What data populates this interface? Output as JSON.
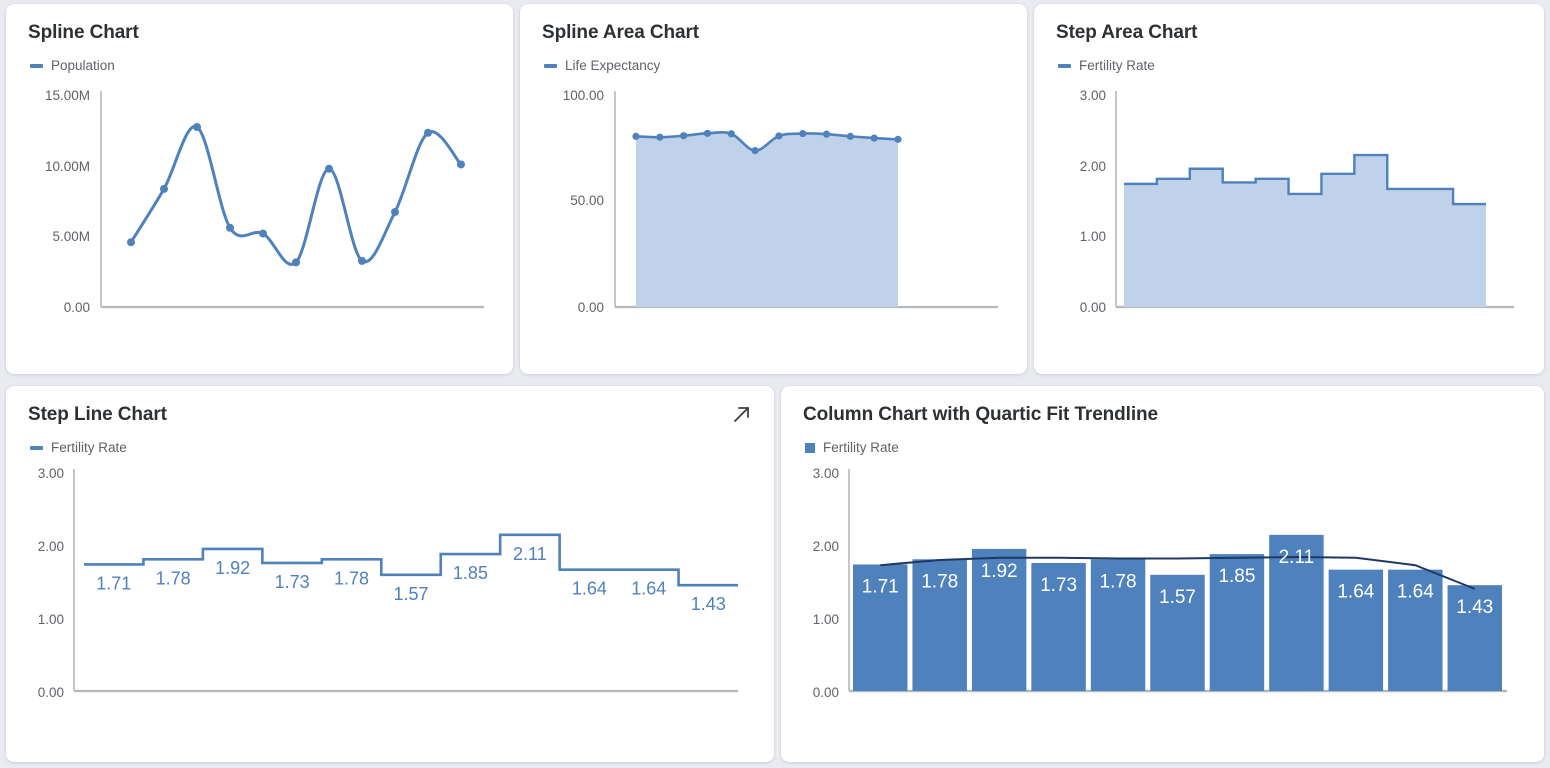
{
  "theme": {
    "page_bg": "#e9ebf1",
    "card_bg": "#ffffff",
    "accent": "#4f81bd",
    "area_fill": "#bfd2ea",
    "trendline": "#1f3864",
    "axis_text": "#5f6368",
    "title_text": "#2d3134"
  },
  "cards": {
    "spline": {
      "title": "Spline Chart",
      "legend": "Population",
      "legend_marker": "line-marker-icon"
    },
    "spline_area": {
      "title": "Spline Area Chart",
      "legend": "Life Expectancy",
      "legend_marker": "line-marker-icon"
    },
    "step_area": {
      "title": "Step Area Chart",
      "legend": "Fertility Rate",
      "legend_marker": "line-marker-icon"
    },
    "step_line": {
      "title": "Step Line Chart",
      "legend": "Fertility Rate",
      "legend_marker": "line-marker-icon",
      "expand_icon": "expand-arrow-icon"
    },
    "column": {
      "title": "Column Chart with Quartic Fit Trendline",
      "legend": "Fertility Rate",
      "legend_marker": "square-marker-icon"
    }
  },
  "chart_data": [
    {
      "id": "spline",
      "type": "line",
      "title": "Spline Chart",
      "xlabel": "",
      "ylabel": "",
      "legend": [
        "Population"
      ],
      "legend_position": "top-left",
      "grid": false,
      "smooth": true,
      "markers": true,
      "ylim": [
        0,
        15000000
      ],
      "yticks": [
        0,
        5000000,
        10000000,
        15000000
      ],
      "ytick_labels": [
        "0.00",
        "5.00M",
        "10.00M",
        "15.00M"
      ],
      "x": [
        1,
        2,
        3,
        4,
        5,
        6,
        7,
        8,
        9,
        10,
        11
      ],
      "series": [
        {
          "name": "Population",
          "color": "#4f81bd",
          "values": [
            4500000,
            8200000,
            12500000,
            5500000,
            5100000,
            3100000,
            9600000,
            3200000,
            6600000,
            12100000,
            9900000
          ]
        }
      ]
    },
    {
      "id": "spline_area",
      "type": "area",
      "title": "Spline Area Chart",
      "xlabel": "",
      "ylabel": "",
      "legend": [
        "Life Expectancy"
      ],
      "legend_position": "top-left",
      "grid": false,
      "smooth": true,
      "markers": true,
      "ylim": [
        0,
        100
      ],
      "yticks": [
        0,
        50,
        100
      ],
      "ytick_labels": [
        "0.00",
        "50.00",
        "100.00"
      ],
      "x": [
        1,
        2,
        3,
        4,
        5,
        6,
        7,
        8,
        9,
        10,
        11,
        12
      ],
      "series": [
        {
          "name": "Life Expectancy",
          "color": "#4f81bd",
          "fill": "#bfd2ea",
          "values": [
            79.0,
            78.6,
            79.3,
            80.4,
            80.2,
            72.4,
            79.2,
            80.3,
            80.0,
            79.0,
            78.2,
            77.6
          ]
        }
      ]
    },
    {
      "id": "step_area",
      "type": "area",
      "title": "Step Area Chart",
      "xlabel": "",
      "ylabel": "",
      "legend": [
        "Fertility Rate"
      ],
      "legend_position": "top-left",
      "grid": false,
      "step": true,
      "ylim": [
        0,
        3
      ],
      "yticks": [
        0,
        1,
        2,
        3
      ],
      "ytick_labels": [
        "0.00",
        "1.00",
        "2.00",
        "3.00"
      ],
      "x": [
        1,
        2,
        3,
        4,
        5,
        6,
        7,
        8,
        9,
        10,
        11
      ],
      "series": [
        {
          "name": "Fertility Rate",
          "color": "#4f81bd",
          "fill": "#bfd2ea",
          "values": [
            1.71,
            1.78,
            1.92,
            1.73,
            1.78,
            1.57,
            1.85,
            2.11,
            1.64,
            1.64,
            1.43
          ]
        }
      ]
    },
    {
      "id": "step_line",
      "type": "line",
      "title": "Step Line Chart",
      "xlabel": "",
      "ylabel": "",
      "legend": [
        "Fertility Rate"
      ],
      "legend_position": "top-left",
      "grid": false,
      "step": true,
      "data_labels": true,
      "ylim": [
        0,
        3
      ],
      "yticks": [
        0,
        1,
        2,
        3
      ],
      "ytick_labels": [
        "0.00",
        "1.00",
        "2.00",
        "3.00"
      ],
      "x": [
        1,
        2,
        3,
        4,
        5,
        6,
        7,
        8,
        9,
        10,
        11
      ],
      "series": [
        {
          "name": "Fertility Rate",
          "color": "#4f81bd",
          "values": [
            1.71,
            1.78,
            1.92,
            1.73,
            1.78,
            1.57,
            1.85,
            2.11,
            1.64,
            1.64,
            1.43
          ],
          "labels": [
            "1.71",
            "1.78",
            "1.92",
            "1.73",
            "1.78",
            "1.57",
            "1.85",
            "2.11",
            "1.64",
            "1.64",
            "1.43"
          ]
        }
      ]
    },
    {
      "id": "column",
      "type": "bar",
      "title": "Column Chart with Quartic Fit Trendline",
      "xlabel": "",
      "ylabel": "",
      "legend": [
        "Fertility Rate"
      ],
      "legend_position": "top-left",
      "grid": false,
      "data_labels": true,
      "ylim": [
        0,
        3
      ],
      "yticks": [
        0,
        1,
        2,
        3
      ],
      "ytick_labels": [
        "0.00",
        "1.00",
        "2.00",
        "3.00"
      ],
      "categories": [
        "1",
        "2",
        "3",
        "4",
        "5",
        "6",
        "7",
        "8",
        "9",
        "10",
        "11"
      ],
      "values": [
        1.71,
        1.78,
        1.92,
        1.73,
        1.78,
        1.57,
        1.85,
        2.11,
        1.64,
        1.64,
        1.43
      ],
      "labels": [
        "1.71",
        "1.78",
        "1.92",
        "1.73",
        "1.78",
        "1.57",
        "1.85",
        "2.11",
        "1.64",
        "1.64",
        "1.43"
      ],
      "bar_color": "#4f81bd",
      "trendline": {
        "name": "Quartic Fit Trendline",
        "color": "#1f3864",
        "values": [
          1.7,
          1.77,
          1.8,
          1.8,
          1.79,
          1.79,
          1.8,
          1.81,
          1.8,
          1.7,
          1.38
        ]
      }
    }
  ]
}
